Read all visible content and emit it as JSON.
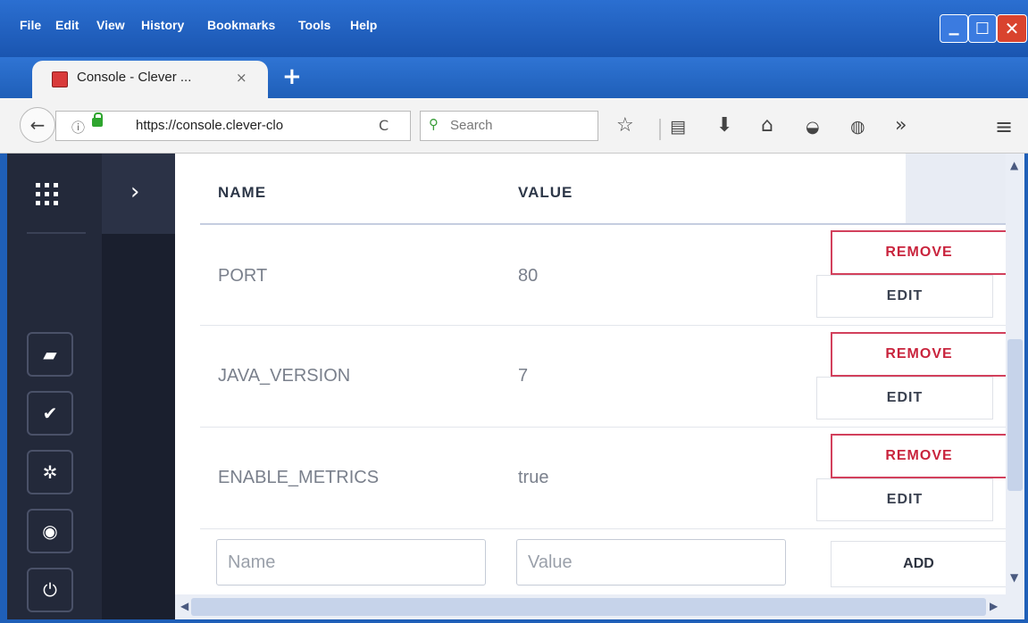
{
  "menu": {
    "file": "File",
    "edit": "Edit",
    "view": "View",
    "history": "History",
    "bookmarks": "Bookmarks",
    "tools": "Tools",
    "help": "Help"
  },
  "window_controls": {
    "minimize": "▁",
    "maximize": "☐",
    "close": "✕"
  },
  "tab": {
    "title": "Console - Clever ...",
    "close": "×",
    "new_tab": "+"
  },
  "navbar": {
    "back": "←",
    "info": "ⓘ",
    "url": "https://console.clever-clo",
    "reload": "C",
    "search_placeholder": "Search",
    "icons": [
      "star-icon",
      "reading-list-icon",
      "download-icon",
      "home-icon",
      "pocket-icon",
      "extension-icon",
      "overflow-icon",
      "menu-icon"
    ],
    "overflow": "»",
    "menu": "≡"
  },
  "sidebar": {
    "expand": "›",
    "buttons": [
      "console-icon",
      "check-icon",
      "gear-icon",
      "help-icon",
      "power-icon"
    ]
  },
  "table": {
    "headers": {
      "name": "NAME",
      "value": "VALUE"
    },
    "rows": [
      {
        "name": "PORT",
        "value": "80"
      },
      {
        "name": "JAVA_VERSION",
        "value": "7"
      },
      {
        "name": "ENABLE_METRICS",
        "value": "true"
      }
    ],
    "remove_label": "REMOVE",
    "edit_label": "EDIT"
  },
  "form": {
    "name_placeholder": "Name",
    "value_placeholder": "Value",
    "add_label": "ADD"
  }
}
